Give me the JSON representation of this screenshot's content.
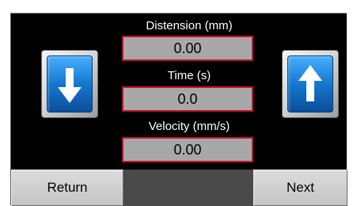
{
  "readings": {
    "distension": {
      "label": "Distension (mm)",
      "value": "0.00"
    },
    "time": {
      "label": "Time (s)",
      "value": "0.0"
    },
    "velocity": {
      "label": "Velocity (mm/s)",
      "value": "0.00"
    }
  },
  "controls": {
    "down_icon": "arrow-down-icon",
    "up_icon": "arrow-up-icon"
  },
  "nav": {
    "return_label": "Return",
    "next_label": "Next"
  },
  "colors": {
    "background": "#000000",
    "field_fill": "#a8a8a8",
    "field_border": "#c8102e",
    "button_blue": "#1478d0"
  }
}
